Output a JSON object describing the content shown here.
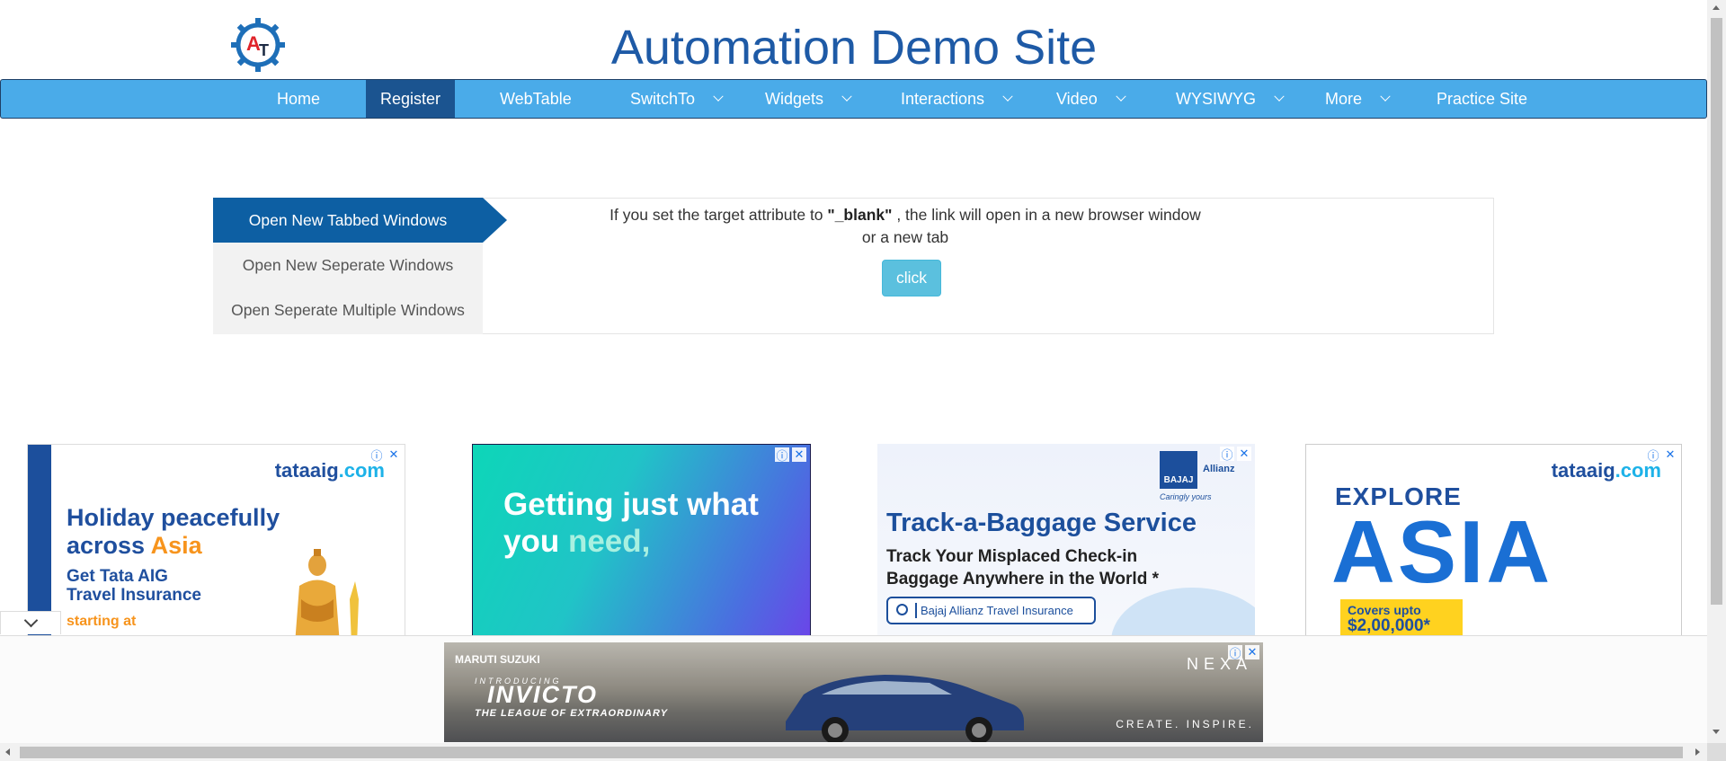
{
  "header": {
    "title": "Automation Demo Site",
    "logo_text": "AT"
  },
  "nav": {
    "items": [
      {
        "label": "Home",
        "dropdown": false,
        "active": false
      },
      {
        "label": "Register",
        "dropdown": false,
        "active": true
      },
      {
        "label": "WebTable",
        "dropdown": false,
        "active": false
      },
      {
        "label": "SwitchTo",
        "dropdown": true,
        "active": false
      },
      {
        "label": "Widgets",
        "dropdown": true,
        "active": false
      },
      {
        "label": "Interactions",
        "dropdown": true,
        "active": false
      },
      {
        "label": "Video",
        "dropdown": true,
        "active": false
      },
      {
        "label": "WYSIWYG",
        "dropdown": true,
        "active": false
      },
      {
        "label": "More",
        "dropdown": true,
        "active": false
      },
      {
        "label": "Practice Site",
        "dropdown": false,
        "active": false
      }
    ]
  },
  "windows": {
    "tabs": [
      {
        "label": "Open New Tabbed Windows",
        "active": true
      },
      {
        "label": "Open New Seperate Windows",
        "active": false
      },
      {
        "label": "Open Seperate Multiple Windows",
        "active": false
      }
    ],
    "description_before": "If you set the target attribute to ",
    "description_code": "\"_blank\"",
    "description_after": " , the link will open in a new browser window or a new tab",
    "button_label": "click"
  },
  "ads": {
    "ad1": {
      "brand": "tataaig",
      "brand_suffix": ".com",
      "headline_1": "Holiday peacefully",
      "headline_2_prefix": "across ",
      "headline_2_highlight": "Asia",
      "sub_1": "Get Tata AIG",
      "sub_2": "Travel Insurance",
      "cta": "starting at"
    },
    "ad2": {
      "line_1": "Getting just what",
      "line_2_prefix": "you ",
      "line_2_highlight": "need,"
    },
    "ad3": {
      "brand": "BAJAJ",
      "brand_partner": "Allianz",
      "tagline": "Caringly yours",
      "title": "Track-a-Baggage Service",
      "sub_1": "Track Your Misplaced Check-in",
      "sub_2": "Baggage Anywhere in the World *",
      "search_text": "Bajaj Allianz Travel Insurance"
    },
    "ad4": {
      "brand": "tataaig",
      "brand_suffix": ".com",
      "explore": "EXPLORE",
      "destination": "ASIA",
      "covers_label": "Covers upto",
      "covers_value": "$2,00,000*"
    },
    "bottom": {
      "maker": "MARUTI SUZUKI",
      "intro": "INTRODUCING",
      "model": "INVICTO",
      "tagline": "THE LEAGUE OF EXTRAORDINARY",
      "brand": "NEXA",
      "slogan": "CREATE. INSPIRE."
    },
    "info_icon": "ⓘ",
    "close_icon": "✕"
  },
  "colors": {
    "nav_bg": "#4aabe9",
    "nav_active": "#1b5490",
    "title": "#1e5aa6",
    "tab_active": "#0d5fa3",
    "button": "#5bc0de"
  }
}
